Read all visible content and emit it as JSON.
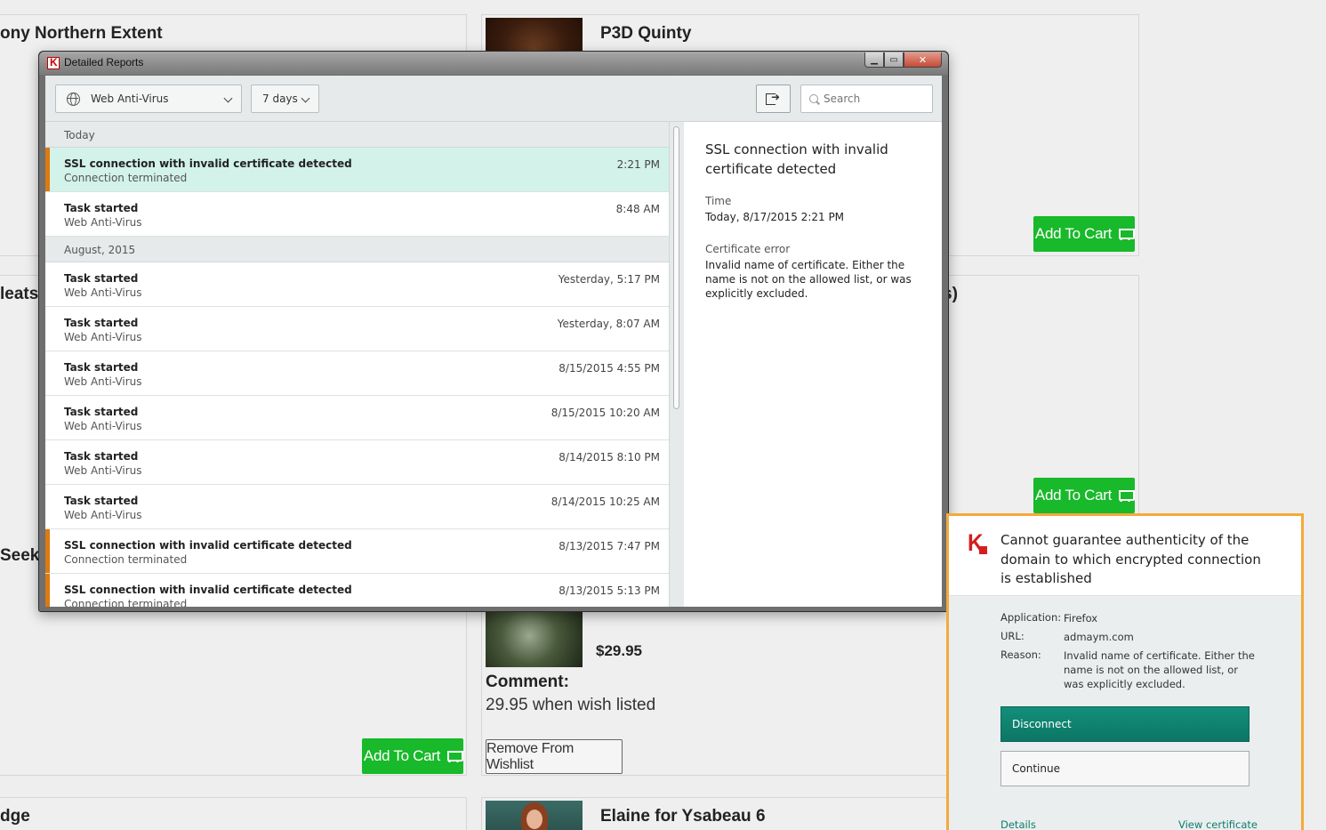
{
  "background": {
    "cards": [
      {
        "title": "ony Northern Extent"
      },
      {
        "title": "P3D Quinty"
      },
      {
        "title": "leats"
      },
      {
        "title": "s)"
      },
      {
        "title": "Seeke"
      },
      {
        "title": "dge"
      },
      {
        "title": "Elaine for Ysabeau 6"
      }
    ],
    "add_to_cart": "Add To Cart",
    "price": "$29.95",
    "comment_label": "Comment:",
    "comment_text": "29.95 when wish listed",
    "remove_button": "Remove From Wishlist"
  },
  "window": {
    "title": "Detailed Reports",
    "controls": {
      "minimize": "▁",
      "maximize": "▭",
      "close": "✕"
    }
  },
  "toolbar": {
    "component_select": "Web Anti-Virus",
    "period_select": "7 days",
    "search_placeholder": "Search"
  },
  "events": {
    "groups": [
      {
        "label": "Today",
        "rows": [
          {
            "title": "SSL connection with invalid certificate detected",
            "subtitle": "Connection terminated",
            "time": "2:21 PM"
          },
          {
            "title": "Task started",
            "subtitle": "Web Anti-Virus",
            "time": "8:48 AM"
          }
        ]
      },
      {
        "label": "August, 2015",
        "rows": [
          {
            "title": "Task started",
            "subtitle": "Web Anti-Virus",
            "time": "Yesterday, 5:17 PM"
          },
          {
            "title": "Task started",
            "subtitle": "Web Anti-Virus",
            "time": "Yesterday, 8:07 AM"
          },
          {
            "title": "Task started",
            "subtitle": "Web Anti-Virus",
            "time": "8/15/2015 4:55 PM"
          },
          {
            "title": "Task started",
            "subtitle": "Web Anti-Virus",
            "time": "8/15/2015 10:20 AM"
          },
          {
            "title": "Task started",
            "subtitle": "Web Anti-Virus",
            "time": "8/14/2015 8:10 PM"
          },
          {
            "title": "Task started",
            "subtitle": "Web Anti-Virus",
            "time": "8/14/2015 10:25 AM"
          },
          {
            "title": "SSL connection with invalid certificate detected",
            "subtitle": "Connection terminated",
            "time": "8/13/2015 7:47 PM"
          },
          {
            "title": "SSL connection with invalid certificate detected",
            "subtitle": "Connection terminated",
            "time": "8/13/2015 5:13 PM"
          }
        ]
      }
    ]
  },
  "detail": {
    "title": "SSL connection with invalid certificate detected",
    "time_label": "Time",
    "time_value": "Today, 8/17/2015 2:21 PM",
    "error_label": "Certificate error",
    "error_value": "Invalid name of certificate. Either the name is not on the allowed list, or was explicitly excluded."
  },
  "popup": {
    "heading": "Cannot guarantee authenticity of the domain to which encrypted connection is established",
    "application_label": "Application:",
    "application_value": "Firefox",
    "url_label": "URL:",
    "url_value": "admaym.com",
    "reason_label": "Reason:",
    "reason_value": "Invalid name of certificate. Either the name is not on the allowed list, or was explicitly excluded.",
    "disconnect_button": "Disconnect",
    "continue_button": "Continue",
    "details_link": "Details",
    "view_certificate_link": "View certificate"
  },
  "colors": {
    "cart_green": "#18b92a",
    "selected_row": "#d2f2ea",
    "alert_marker": "#dd7a10",
    "popup_border": "#f5a93a",
    "disconnect_teal": "#0c7664"
  }
}
